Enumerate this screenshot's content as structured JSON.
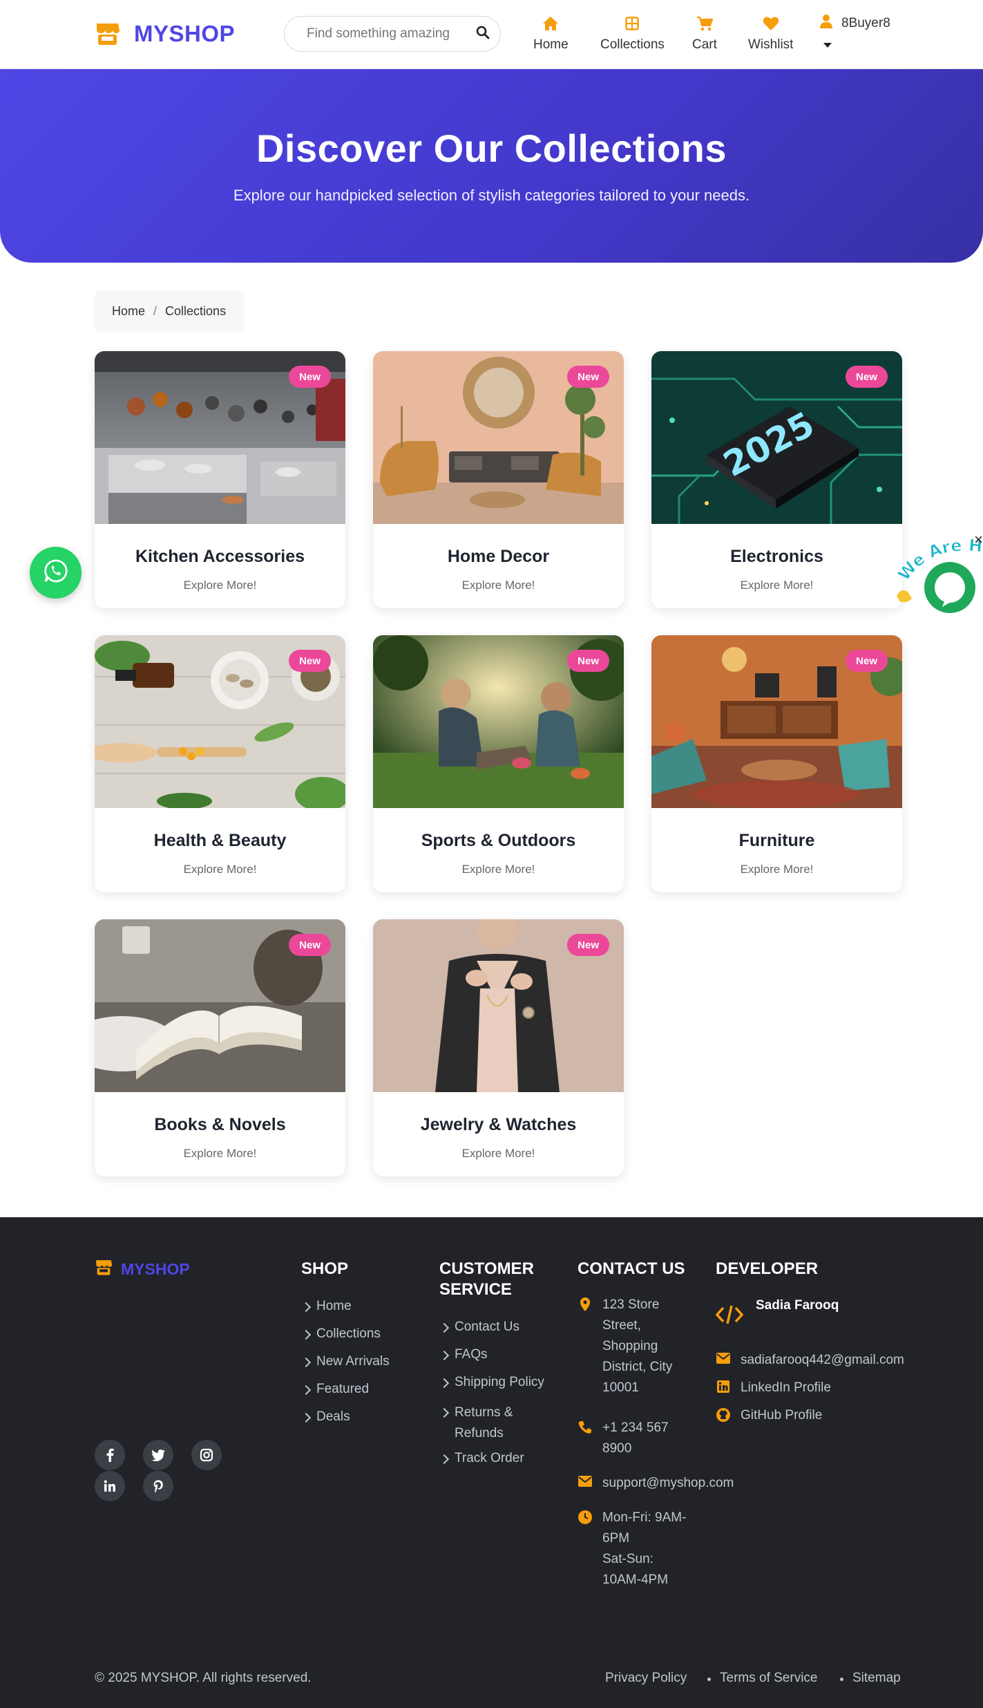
{
  "brand": {
    "name": "MYSHOP"
  },
  "search": {
    "placeholder": "Find something amazing"
  },
  "nav": {
    "items": [
      {
        "label": "Home",
        "icon": "home-icon"
      },
      {
        "label": "Collections",
        "icon": "grid-icon"
      },
      {
        "label": "Cart",
        "icon": "cart-icon"
      },
      {
        "label": "Wishlist",
        "icon": "heart-icon"
      }
    ],
    "user": {
      "name": "8Buyer8",
      "icon": "user-icon"
    }
  },
  "hero": {
    "title": "Discover Our Collections",
    "subtitle": "Explore our handpicked selection of stylish categories tailored to your needs."
  },
  "breadcrumb": {
    "items": [
      "Home",
      "Collections"
    ],
    "separator": "/"
  },
  "collections": [
    {
      "title": "Kitchen Accessories",
      "subtitle": "Explore More!",
      "badge": "New"
    },
    {
      "title": "Home Decor",
      "subtitle": "Explore More!",
      "badge": "New"
    },
    {
      "title": "Electronics",
      "subtitle": "Explore More!",
      "badge": "New",
      "image_text": "2025"
    },
    {
      "title": "Health & Beauty",
      "subtitle": "Explore More!",
      "badge": "New"
    },
    {
      "title": "Sports & Outdoors",
      "subtitle": "Explore More!",
      "badge": "New"
    },
    {
      "title": "Furniture",
      "subtitle": "Explore More!",
      "badge": "New"
    },
    {
      "title": "Books & Novels",
      "subtitle": "Explore More!",
      "badge": "New"
    },
    {
      "title": "Jewelry & Watches",
      "subtitle": "Explore More!",
      "badge": "New"
    }
  ],
  "chat_widget": {
    "label": "We Are Here",
    "close": "×"
  },
  "footer": {
    "brand": "MYSHOP",
    "shop": {
      "heading": "SHOP",
      "links": [
        "Home",
        "Collections",
        "New Arrivals",
        "Featured",
        "Deals"
      ]
    },
    "customer_service": {
      "heading": "CUSTOMER SERVICE",
      "links": [
        "Contact Us",
        "FAQs",
        "Shipping Policy",
        "Returns & Refunds",
        "Track Order"
      ]
    },
    "contact": {
      "heading": "CONTACT US",
      "address": "123 Store Street, Shopping District, City 10001",
      "phone": "+1 234 567 8900",
      "email": "support@myshop.com",
      "hours_weekday": "Mon-Fri: 9AM-6PM",
      "hours_weekend": "Sat-Sun: 10AM-4PM"
    },
    "developer": {
      "heading": "DEVELOPER",
      "name": "Sadia Farooq",
      "email": "sadiafarooq442@gmail.com",
      "linkedin": "LinkedIn Profile",
      "github": "GitHub Profile"
    },
    "social": [
      "facebook-icon",
      "twitter-icon",
      "instagram-icon",
      "linkedin-icon",
      "pinterest-icon"
    ],
    "copyright": "© 2025 MYSHOP. All rights reserved.",
    "legal": [
      "Privacy Policy",
      "Terms of Service",
      "Sitemap"
    ]
  },
  "colors": {
    "primary": "#4f46e5",
    "accent": "#f59e0b",
    "badge": "#ec4899",
    "whatsapp": "#25d366",
    "footer_bg": "#212328"
  }
}
